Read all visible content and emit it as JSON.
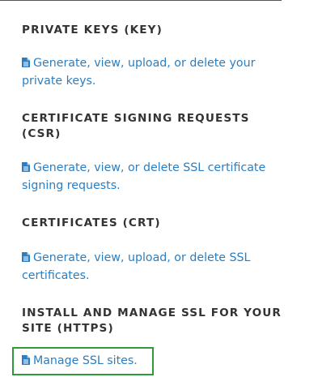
{
  "sections": [
    {
      "title": "PRIVATE KEYS (KEY)",
      "link_text": "Generate, view, upload, or delete your private keys.",
      "icon": "document-icon"
    },
    {
      "title": "CERTIFICATE SIGNING REQUESTS (CSR)",
      "link_text": "Generate, view, or delete SSL certificate signing requests.",
      "icon": "document-icon"
    },
    {
      "title": "CERTIFICATES (CRT)",
      "link_text": "Generate, view, upload, or delete SSL certificates.",
      "icon": "document-icon"
    },
    {
      "title": "INSTALL AND MANAGE SSL FOR YOUR SITE (HTTPS)",
      "link_text": "Manage SSL sites.",
      "icon": "document-icon",
      "highlighted": true
    }
  ],
  "colors": {
    "link": "#2b7ec1",
    "heading": "#333333",
    "highlight_border": "#2e9b3a",
    "background": "#ffffff"
  }
}
